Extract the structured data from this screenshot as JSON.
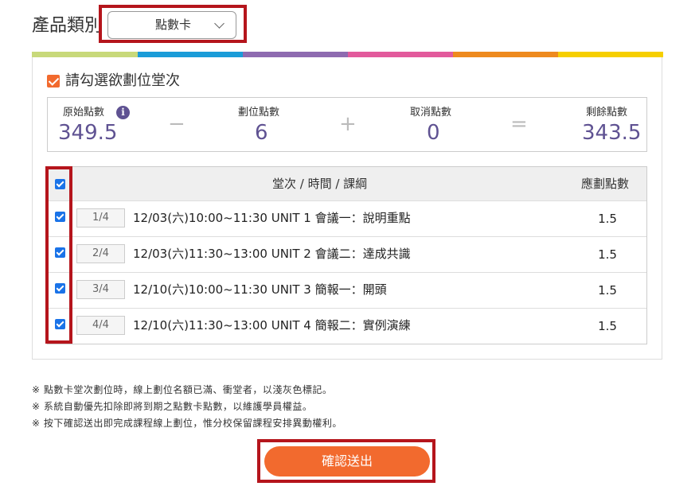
{
  "category": {
    "label": "產品類別",
    "selected": "點數卡"
  },
  "stripe_colors": [
    "#c8d97a",
    "#1a9cd8",
    "#8e6bb0",
    "#e25a9c",
    "#ee8a1e",
    "#f6cf00"
  ],
  "instruction": "請勾選欲劃位堂次",
  "points": {
    "original_label": "原始點數",
    "original_value": "349.5",
    "minus": "−",
    "booked_label": "劃位點數",
    "booked_value": "6",
    "plus": "+",
    "cancel_label": "取消點數",
    "cancel_value": "0",
    "equals": "=",
    "remaining_label": "剩餘點數",
    "remaining_value": "343.5",
    "info_icon": "i"
  },
  "table": {
    "header_session": "堂次 / 時間 / 課綱",
    "header_points": "應劃點數",
    "rows": [
      {
        "seq": "1/4",
        "session": "12/03(六)10:00~11:30   UNIT 1 會議一：說明重點",
        "points": "1.5",
        "checked": true
      },
      {
        "seq": "2/4",
        "session": "12/03(六)11:30~13:00   UNIT 2 會議二：達成共識",
        "points": "1.5",
        "checked": true
      },
      {
        "seq": "3/4",
        "session": "12/10(六)10:00~11:30   UNIT 3 簡報一：開頭",
        "points": "1.5",
        "checked": true
      },
      {
        "seq": "4/4",
        "session": "12/10(六)11:30~13:00   UNIT 4 簡報二：實例演練",
        "points": "1.5",
        "checked": true
      }
    ]
  },
  "notes": [
    "※ 點數卡堂次劃位時，線上劃位名額已滿、衝堂者，以淺灰色標記。",
    "※ 系統自動優先扣除即將到期之點數卡點數，以維護學員權益。",
    "※ 按下確認送出即完成課程線上劃位，惟分校保留課程安排異動權利。"
  ],
  "submit_label": "確認送出",
  "colors": {
    "accent": "#f26a2e",
    "value_purple": "#5f5292",
    "highlight_red": "#b5151c",
    "checkbox_blue": "#1a73e8"
  }
}
